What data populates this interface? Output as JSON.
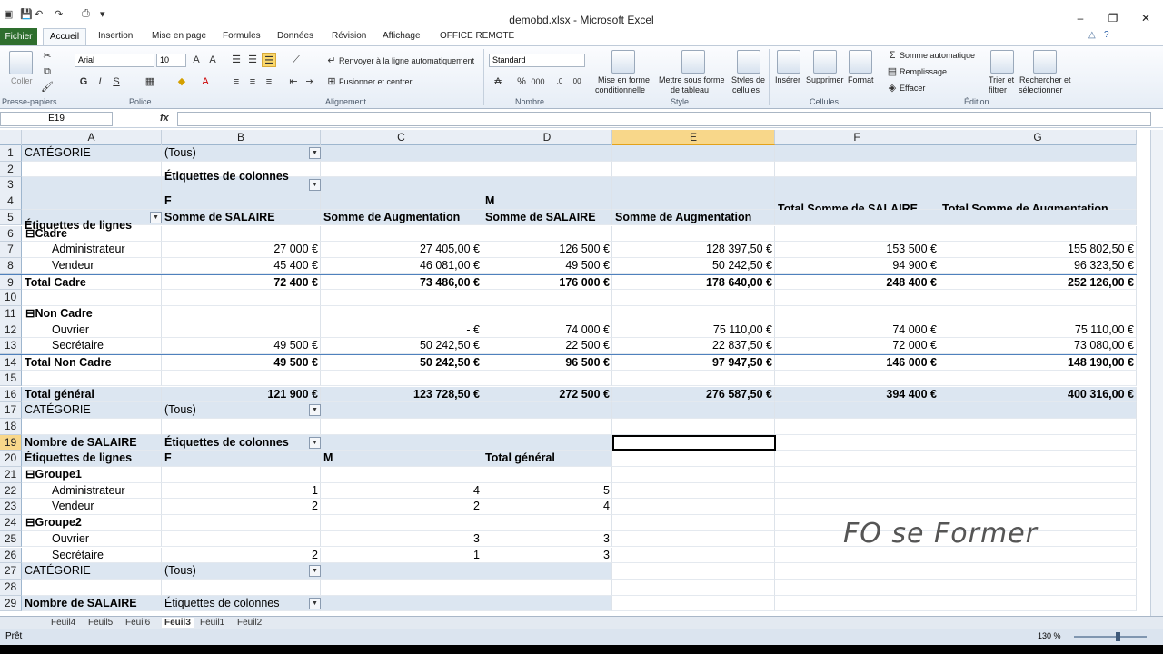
{
  "window": {
    "title": "demobd.xlsx  -  Microsoft Excel"
  },
  "ribbon_tabs": [
    "Fichier",
    "Accueil",
    "Insertion",
    "Mise en page",
    "Formules",
    "Données",
    "Révision",
    "Affichage",
    "OFFICE REMOTE"
  ],
  "ribbon": {
    "paste": "Coller",
    "clipboard": "Presse-papiers",
    "font_name": "Arial",
    "font_size": "10",
    "font_group": "Police",
    "wrap": "Renvoyer à la ligne automatiquement",
    "merge": "Fusionner et centrer",
    "align_group": "Alignement",
    "number_format": "Standard",
    "number_group": "Nombre",
    "cond_format": [
      "Mise en forme",
      "conditionnelle"
    ],
    "table_format": [
      "Mettre sous forme",
      "de tableau"
    ],
    "cell_styles": [
      "Styles de",
      "cellules"
    ],
    "style_group": "Style",
    "insert": "Insérer",
    "delete": "Supprimer",
    "format": "Format",
    "cells_group": "Cellules",
    "autosum": "Somme automatique",
    "fill": "Remplissage",
    "clear": "Effacer",
    "sort": [
      "Trier et",
      "filtrer"
    ],
    "find": [
      "Rechercher et",
      "sélectionner"
    ],
    "edit_group": "Édition"
  },
  "formula": {
    "cell_ref": "E19",
    "fx": "fx",
    "content": ""
  },
  "columns": [
    "A",
    "B",
    "C",
    "D",
    "E",
    "F",
    "G"
  ],
  "rows": [
    {
      "n": "1",
      "cells": [
        "CATÉGORIE",
        "(Tous)",
        "",
        "",
        "",
        "",
        ""
      ]
    },
    {
      "n": "2",
      "cells": [
        "",
        "",
        "",
        "",
        "",
        "",
        ""
      ]
    },
    {
      "n": "3",
      "cells": [
        "",
        "Étiquettes de colonnes",
        "",
        "",
        "",
        "",
        ""
      ]
    },
    {
      "n": "4",
      "cells": [
        "",
        "F",
        "",
        "M",
        "",
        "Total Somme de SALAIRE",
        "Total Somme de Augmentation"
      ]
    },
    {
      "n": "5",
      "cells": [
        "Étiquettes de lignes",
        "Somme de SALAIRE",
        "Somme de Augmentation",
        "Somme de SALAIRE",
        "Somme de Augmentation",
        "",
        ""
      ]
    },
    {
      "n": "6",
      "cells": [
        "⊟Cadre",
        "",
        "",
        "",
        "",
        "",
        ""
      ]
    },
    {
      "n": "7",
      "cells": [
        "Administrateur",
        "27 000 €",
        "27 405,00 €",
        "126 500 €",
        "128 397,50 €",
        "153 500 €",
        "155 802,50 €"
      ]
    },
    {
      "n": "8",
      "cells": [
        "Vendeur",
        "45 400 €",
        "46 081,00 €",
        "49 500 €",
        "50 242,50 €",
        "94 900 €",
        "96 323,50 €"
      ]
    },
    {
      "n": "9",
      "cells": [
        "Total Cadre",
        "72 400 €",
        "73 486,00 €",
        "176 000 €",
        "178 640,00 €",
        "248 400 €",
        "252 126,00 €"
      ]
    },
    {
      "n": "10",
      "cells": [
        "",
        "",
        "",
        "",
        "",
        "",
        ""
      ]
    },
    {
      "n": "11",
      "cells": [
        "⊟Non Cadre",
        "",
        "",
        "",
        "",
        "",
        ""
      ]
    },
    {
      "n": "12",
      "cells": [
        "Ouvrier",
        "",
        "-      €",
        "74 000 €",
        "75 110,00 €",
        "74 000 €",
        "75 110,00 €"
      ]
    },
    {
      "n": "13",
      "cells": [
        "Secrétaire",
        "49 500 €",
        "50 242,50 €",
        "22 500 €",
        "22 837,50 €",
        "72 000 €",
        "73 080,00 €"
      ]
    },
    {
      "n": "14",
      "cells": [
        "Total Non Cadre",
        "49 500 €",
        "50 242,50 €",
        "96 500 €",
        "97 947,50 €",
        "146 000 €",
        "148 190,00 €"
      ]
    },
    {
      "n": "15",
      "cells": [
        "",
        "",
        "",
        "",
        "",
        "",
        ""
      ]
    },
    {
      "n": "16",
      "cells": [
        "Total général",
        "121 900 €",
        "123 728,50 €",
        "272 500 €",
        "276 587,50 €",
        "394 400 €",
        "400 316,00 €"
      ]
    },
    {
      "n": "17",
      "cells": [
        "CATÉGORIE",
        "(Tous)",
        "",
        "",
        "",
        "",
        ""
      ]
    },
    {
      "n": "18",
      "cells": [
        "",
        "",
        "",
        "",
        "",
        "",
        ""
      ]
    },
    {
      "n": "19",
      "cells": [
        "Nombre de SALAIRE",
        "Étiquettes de colonnes",
        "",
        "",
        "",
        "",
        ""
      ]
    },
    {
      "n": "20",
      "cells": [
        "Étiquettes de lignes",
        "F",
        "M",
        "Total général",
        "",
        "",
        ""
      ]
    },
    {
      "n": "21",
      "cells": [
        "⊟Groupe1",
        "",
        "",
        "",
        "",
        "",
        ""
      ]
    },
    {
      "n": "22",
      "cells": [
        "Administrateur",
        "1",
        "4",
        "5",
        "",
        "",
        ""
      ]
    },
    {
      "n": "23",
      "cells": [
        "Vendeur",
        "2",
        "2",
        "4",
        "",
        "",
        ""
      ]
    },
    {
      "n": "24",
      "cells": [
        "⊟Groupe2",
        "",
        "",
        "",
        "",
        "",
        ""
      ]
    },
    {
      "n": "25",
      "cells": [
        "Ouvrier",
        "",
        "3",
        "3",
        "",
        "",
        ""
      ]
    },
    {
      "n": "26",
      "cells": [
        "Secrétaire",
        "2",
        "1",
        "3",
        "",
        "",
        ""
      ]
    },
    {
      "n": "27",
      "cells": [
        "CATÉGORIE",
        "(Tous)",
        "",
        "",
        "",
        "",
        ""
      ]
    },
    {
      "n": "28",
      "cells": [
        "",
        "",
        "",
        "",
        "",
        "",
        ""
      ]
    },
    {
      "n": "29",
      "cells": [
        "Nombre de SALAIRE",
        "Étiquettes de colonnes",
        "",
        "",
        "",
        "",
        ""
      ]
    }
  ],
  "sheets": [
    "Feuil4",
    "Feuil5",
    "Feuil6",
    "Feuil3",
    "Feuil1",
    "Feuil2"
  ],
  "active_sheet": "Feuil3",
  "status": {
    "ready": "Prêt",
    "zoom": "130 %"
  },
  "watermark": "FO se Former"
}
